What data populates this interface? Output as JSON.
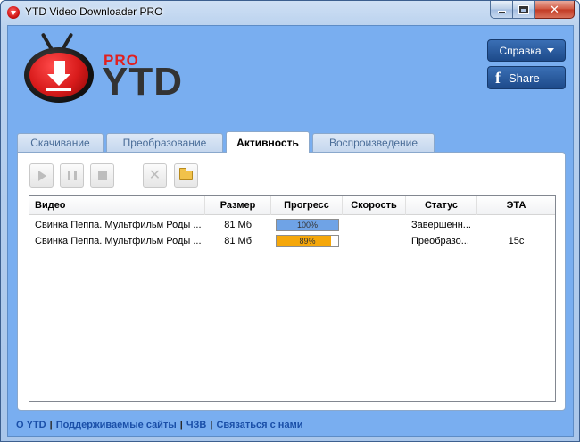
{
  "window": {
    "title": "YTD Video Downloader PRO",
    "min_icon": "minimize-icon",
    "max_icon": "maximize-icon",
    "close_icon": "close-icon",
    "close_glyph": "✕"
  },
  "logo": {
    "pro": "PRO",
    "ytd": "YTD"
  },
  "header_buttons": {
    "help_label": "Справка",
    "share_label": "Share",
    "facebook_glyph": "f"
  },
  "tabs": [
    {
      "label": "Скачивание",
      "active": false
    },
    {
      "label": "Преобразование",
      "active": false
    },
    {
      "label": "Активность",
      "active": true
    },
    {
      "label": "Воспроизведение",
      "active": false
    }
  ],
  "toolbar": {
    "buttons": [
      "play-icon",
      "pause-icon",
      "stop-icon",
      "delete-icon",
      "folder-icon"
    ],
    "delete_glyph": "✕"
  },
  "table": {
    "columns": [
      "Видео",
      "Размер",
      "Прогресс",
      "Скорость",
      "Статус",
      "ЭТА"
    ],
    "rows": [
      {
        "video": "Свинка Пеппа. Мультфильм Роды ...",
        "size": "81 Мб",
        "progress": 100,
        "progress_label": "100%",
        "progress_color": "#6fa3e6",
        "speed": "",
        "status": "Завершенн...",
        "eta": ""
      },
      {
        "video": "Свинка Пеппа. Мультфильм Роды ...",
        "size": "81 Мб",
        "progress": 89,
        "progress_label": "89%",
        "progress_color": "#f5a70a",
        "speed": "",
        "status": "Преобразо...",
        "eta": "15с"
      }
    ]
  },
  "footer": {
    "links": [
      "О YTD",
      "Поддерживаемые сайты",
      "ЧЗВ",
      "Связаться с нами"
    ],
    "separator": "|"
  }
}
